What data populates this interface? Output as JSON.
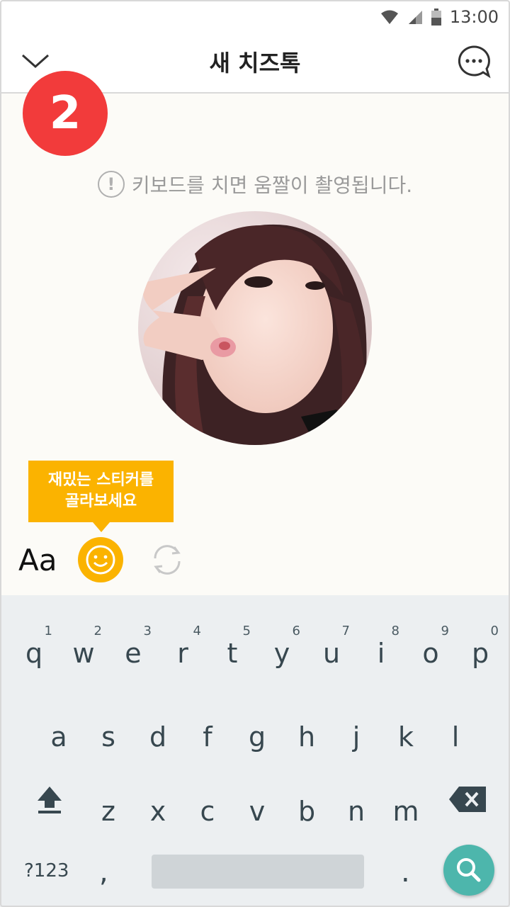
{
  "status_bar": {
    "time": "13:00"
  },
  "header": {
    "title": "새 치즈톡"
  },
  "step_badge": "2",
  "notice_text": "키보드를 치면 움짤이 촬영됩니다.",
  "tooltip": {
    "line1": "재밌는 스티커를",
    "line2": "골라보세요"
  },
  "toolbar": {
    "font_label": "Aa"
  },
  "keyboard": {
    "row1": [
      {
        "ch": "q",
        "num": "1"
      },
      {
        "ch": "w",
        "num": "2"
      },
      {
        "ch": "e",
        "num": "3"
      },
      {
        "ch": "r",
        "num": "4"
      },
      {
        "ch": "t",
        "num": "5"
      },
      {
        "ch": "y",
        "num": "6"
      },
      {
        "ch": "u",
        "num": "7"
      },
      {
        "ch": "i",
        "num": "8"
      },
      {
        "ch": "o",
        "num": "9"
      },
      {
        "ch": "p",
        "num": "0"
      }
    ],
    "row2": [
      "a",
      "s",
      "d",
      "f",
      "g",
      "h",
      "j",
      "k",
      "l"
    ],
    "row3": [
      "z",
      "x",
      "c",
      "v",
      "b",
      "n",
      "m"
    ],
    "mode_label": "?123",
    "comma": ",",
    "period": "."
  },
  "colors": {
    "accent_yellow": "#fbb300",
    "badge_red": "#f23b3b",
    "search_teal": "#4db6ac",
    "content_bg": "#fcfbf7",
    "keyboard_bg": "#eceff1"
  }
}
